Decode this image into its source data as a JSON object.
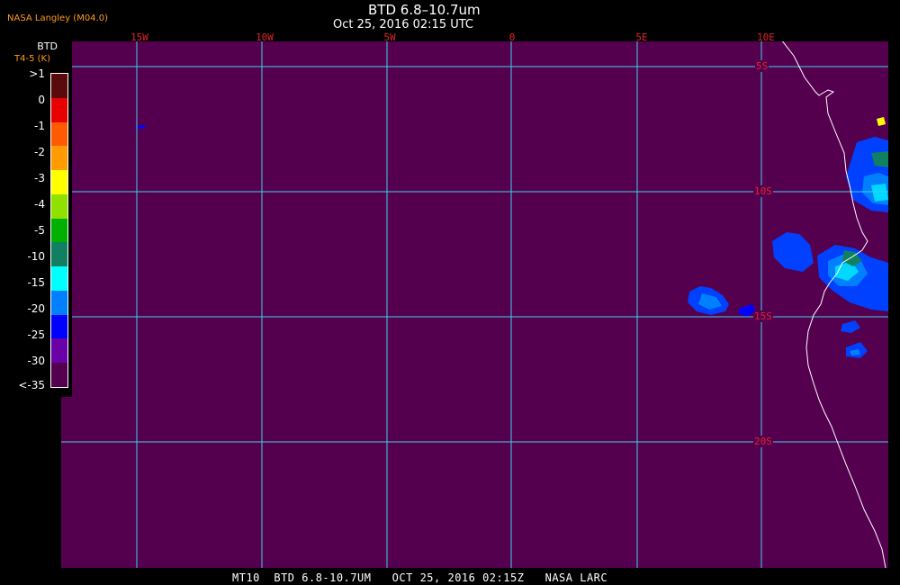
{
  "producer": "NASA Langley (M04.0)",
  "title": "BTD 6.8–10.7um",
  "subtitle": "Oct 25, 2016 02:15 UTC",
  "footer": "MT10  BTD 6.8-10.7UM   OCT 25, 2016 02:15Z   NASA LARC",
  "legend": {
    "title": "BTD",
    "subtitle": "T4-5 (K)",
    "labels": [
      ">1",
      "0",
      "-1",
      "-2",
      "-3",
      "-4",
      "-5",
      "-10",
      "-15",
      "-20",
      "-25",
      "-30",
      "<-35"
    ],
    "colors": [
      "#5a0a0a",
      "#e60000",
      "#ff5a00",
      "#ff9a00",
      "#ffff00",
      "#90e000",
      "#00b000",
      "#108060",
      "#00ffff",
      "#0080ff",
      "#0000ff",
      "#6a00a8",
      "#54004f"
    ]
  },
  "grid": {
    "longitudes": [
      "15W",
      "10W",
      "5W",
      "0",
      "5E",
      "10E"
    ],
    "latitudes": [
      "5S",
      "10S",
      "15S",
      "20S"
    ]
  },
  "colors": {
    "background": "#54004f",
    "gridline": "#3fd0e6",
    "coastline": "#ffffff",
    "grid_label": "#e0242a"
  }
}
